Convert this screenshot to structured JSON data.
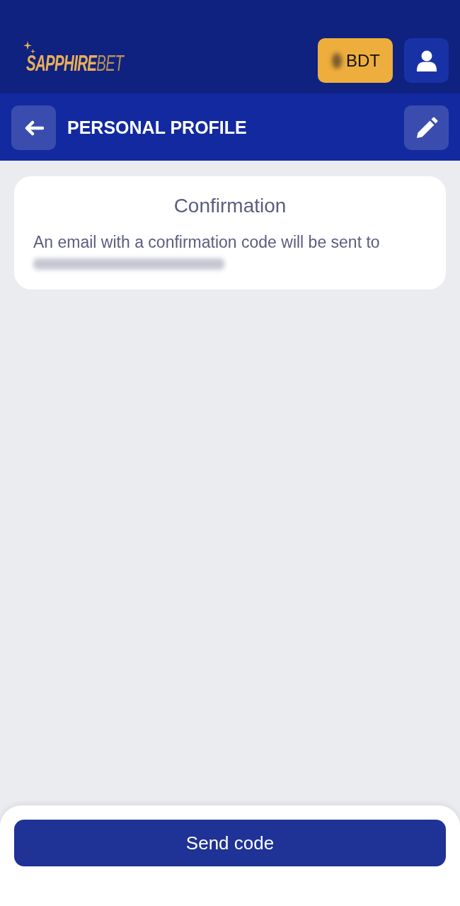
{
  "header": {
    "logo": "**SAPPHIRE**BET",
    "currency_button": {
      "label": "BDT"
    }
  },
  "page_bar": {
    "title": "PERSONAL PROFILE"
  },
  "card": {
    "title": "Confirmation",
    "message": "An email with a confirmation code will be sent to"
  },
  "footer": {
    "button": "Send code"
  }
}
